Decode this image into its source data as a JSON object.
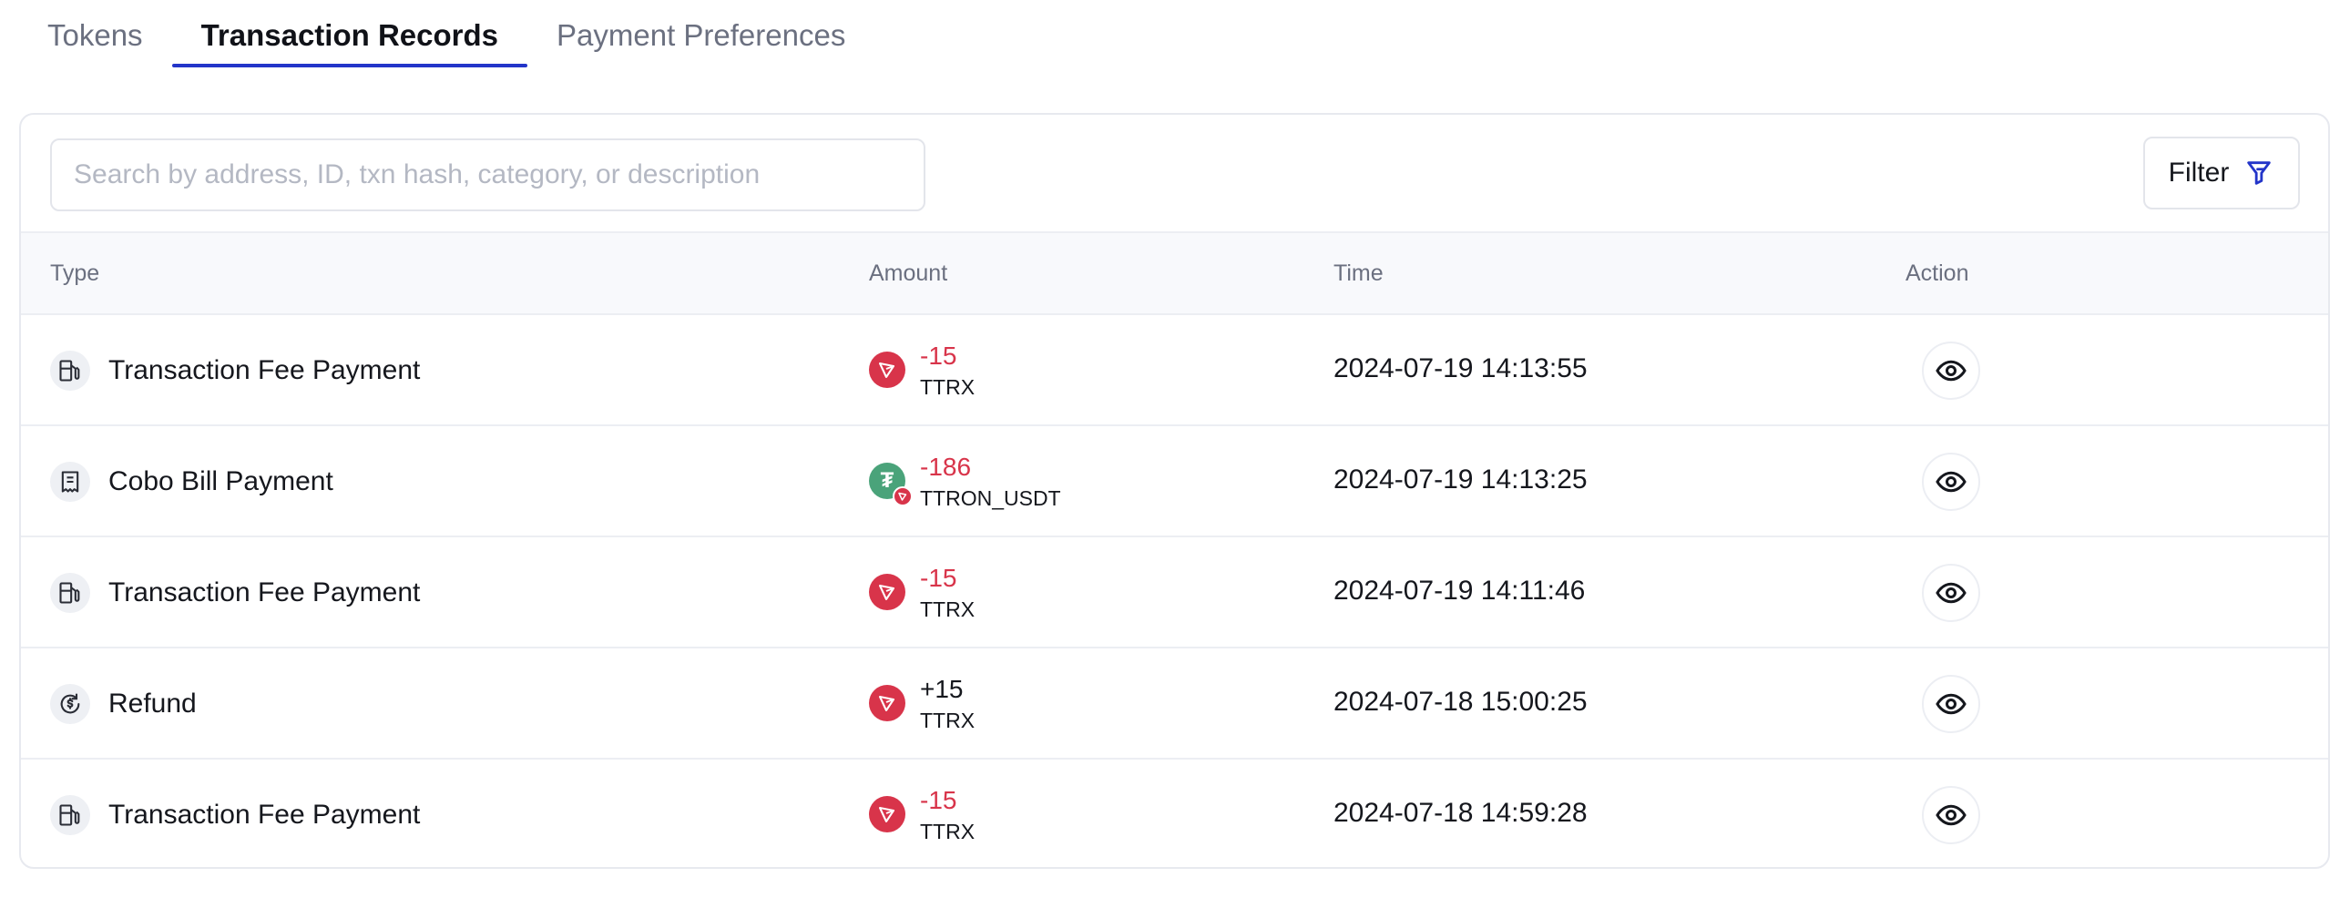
{
  "tabs": [
    {
      "label": "Tokens",
      "active": false
    },
    {
      "label": "Transaction Records",
      "active": true
    },
    {
      "label": "Payment Preferences",
      "active": false
    }
  ],
  "search": {
    "placeholder": "Search by address, ID, txn hash, category, or description",
    "value": ""
  },
  "filter": {
    "label": "Filter",
    "icon": "filter-icon"
  },
  "table": {
    "headers": {
      "type": "Type",
      "amount": "Amount",
      "time": "Time",
      "action": "Action"
    },
    "rows": [
      {
        "type": "Transaction Fee Payment",
        "type_icon": "fuel-pump-icon",
        "amount": "-15",
        "symbol": "TTRX",
        "coin_icon": "tron-icon",
        "time": "2024-07-19 14:13:55",
        "action_icon": "eye-icon"
      },
      {
        "type": "Cobo Bill Payment",
        "type_icon": "receipt-icon",
        "amount": "-186",
        "symbol": "TTRON_USDT",
        "coin_icon": "tether-icon",
        "coin_glyph": "₮",
        "time": "2024-07-19 14:13:25",
        "action_icon": "eye-icon"
      },
      {
        "type": "Transaction Fee Payment",
        "type_icon": "fuel-pump-icon",
        "amount": "-15",
        "symbol": "TTRX",
        "coin_icon": "tron-icon",
        "time": "2024-07-19 14:11:46",
        "action_icon": "eye-icon"
      },
      {
        "type": "Refund",
        "type_icon": "refund-icon",
        "amount": "+15",
        "symbol": "TTRX",
        "coin_icon": "tron-icon",
        "time": "2024-07-18 15:00:25",
        "action_icon": "eye-icon"
      },
      {
        "type": "Transaction Fee Payment",
        "type_icon": "fuel-pump-icon",
        "amount": "-15",
        "symbol": "TTRX",
        "coin_icon": "tron-icon",
        "time": "2024-07-18 14:59:28",
        "action_icon": "eye-icon"
      }
    ]
  },
  "colors": {
    "accent": "#2335c9",
    "negative": "#d8344a",
    "tron": "#d8344a",
    "tether": "#4aa37a"
  }
}
